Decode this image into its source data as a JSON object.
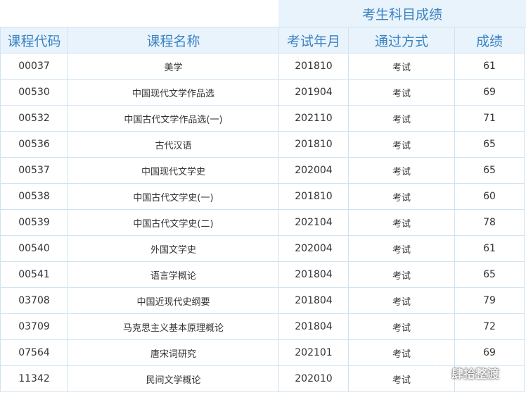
{
  "header": {
    "section_title": "考生科目成绩",
    "columns": [
      "课程代码",
      "课程名称",
      "考试年月",
      "通过方式",
      "成绩"
    ]
  },
  "rows": [
    {
      "code": "00037",
      "name": "美学",
      "date": "201810",
      "method": "考试",
      "score": "61"
    },
    {
      "code": "00530",
      "name": "中国现代文学作品选",
      "date": "201904",
      "method": "考试",
      "score": "69"
    },
    {
      "code": "00532",
      "name": "中国古代文学作品选(一)",
      "date": "202110",
      "method": "考试",
      "score": "71"
    },
    {
      "code": "00536",
      "name": "古代汉语",
      "date": "201810",
      "method": "考试",
      "score": "65"
    },
    {
      "code": "00537",
      "name": "中国现代文学史",
      "date": "202004",
      "method": "考试",
      "score": "65"
    },
    {
      "code": "00538",
      "name": "中国古代文学史(一)",
      "date": "201810",
      "method": "考试",
      "score": "60"
    },
    {
      "code": "00539",
      "name": "中国古代文学史(二)",
      "date": "202104",
      "method": "考试",
      "score": "78"
    },
    {
      "code": "00540",
      "name": "外国文学史",
      "date": "202004",
      "method": "考试",
      "score": "61"
    },
    {
      "code": "00541",
      "name": "语言学概论",
      "date": "201804",
      "method": "考试",
      "score": "65"
    },
    {
      "code": "03708",
      "name": "中国近现代史纲要",
      "date": "201804",
      "method": "考试",
      "score": "79"
    },
    {
      "code": "03709",
      "name": "马克思主义基本原理概论",
      "date": "201804",
      "method": "考试",
      "score": "72"
    },
    {
      "code": "07564",
      "name": "唐宋词研究",
      "date": "202101",
      "method": "考试",
      "score": "69"
    },
    {
      "code": "11342",
      "name": "民间文学概论",
      "date": "202010",
      "method": "考试",
      "score": ""
    }
  ],
  "watermark": {
    "icon": "wechat-icon",
    "text": "肆拾整渡"
  },
  "colors": {
    "header_bg": "#e9f3fc",
    "header_text": "#3a83c3",
    "border": "#cfe3f2",
    "body_text": "#333333"
  }
}
